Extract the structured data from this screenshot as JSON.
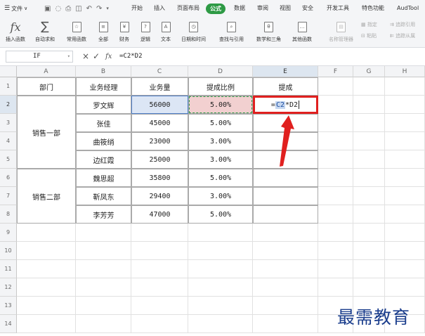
{
  "menubar": {
    "file_menu": "文件",
    "tabs": [
      "开始",
      "插入",
      "页面布局",
      "公式",
      "数据",
      "审阅",
      "视图",
      "安全",
      "开发工具",
      "特色功能",
      "AudTool"
    ],
    "active_tab": "公式"
  },
  "ribbon": {
    "fx_symbol": "fx",
    "sum_symbol": "∑",
    "buttons": [
      "插入函数",
      "自动求和",
      "常用函数",
      "全部",
      "财务",
      "逻辑",
      "文本",
      "日期和时间",
      "查找与引用",
      "数学和三角",
      "其他函数",
      "名称管理器"
    ],
    "small_buttons": [
      "指定",
      "粘贴",
      "追踪引用",
      "追踪从属"
    ]
  },
  "formula_bar": {
    "name_box": "IF",
    "cancel_symbol": "×",
    "confirm_symbol": "✓",
    "fx_symbol": "fx",
    "content": "=C2*D2"
  },
  "sheet": {
    "columns": [
      "A",
      "B",
      "C",
      "D",
      "E",
      "F",
      "G",
      "H"
    ],
    "rows": [
      "1",
      "2",
      "3",
      "4",
      "5",
      "6",
      "7",
      "8",
      "9",
      "10",
      "11",
      "12",
      "13",
      "14"
    ],
    "headers": [
      "部门",
      "业务经理",
      "业务量",
      "提成比例",
      "提成"
    ],
    "groups": [
      "销售一部",
      "销售二部"
    ],
    "data": [
      [
        "罗文辉",
        "56000",
        "5.00%"
      ],
      [
        "张佳",
        "45000",
        "5.00%"
      ],
      [
        "曲筱绡",
        "23000",
        "3.00%"
      ],
      [
        "边红霞",
        "25000",
        "3.00%"
      ],
      [
        "魏思超",
        "35800",
        "5.00%"
      ],
      [
        "靳凤东",
        "29400",
        "3.00%"
      ],
      [
        "李芳芳",
        "47000",
        "5.00%"
      ]
    ],
    "editing": {
      "eq": "=",
      "ref1": "C2",
      "op": "*",
      "ref2": "D2"
    }
  },
  "watermark": "最需教育",
  "colors": {
    "active_tab": "#2e9a45",
    "selected_ref": "#dce6f5",
    "dependent_ref": "#f2d0d0",
    "highlight_box": "#e0201f",
    "arrow": "#e0201f"
  }
}
